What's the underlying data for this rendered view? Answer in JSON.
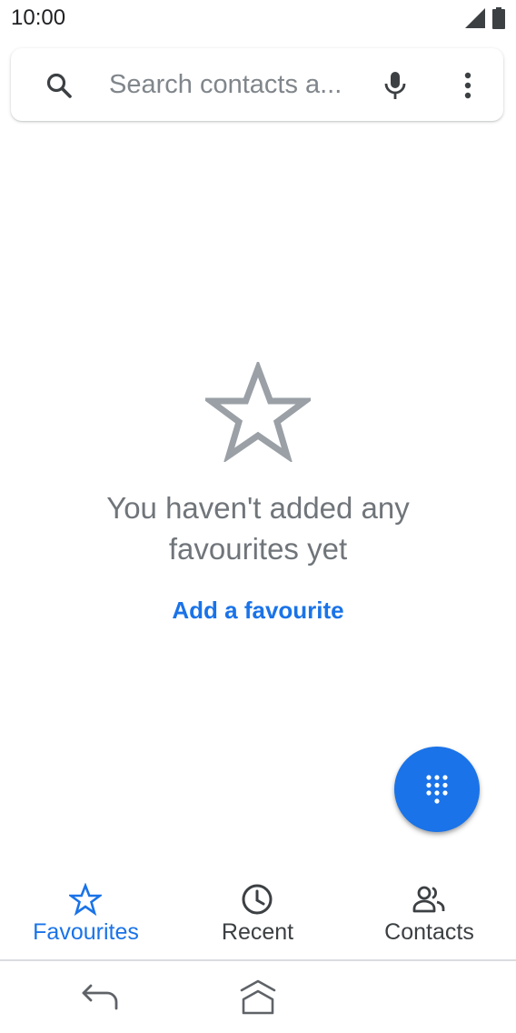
{
  "status_bar": {
    "time": "10:00",
    "icons": [
      "signal-icon",
      "battery-icon"
    ]
  },
  "search": {
    "placeholder": "Search contacts a...",
    "icons": [
      "search-icon",
      "mic-icon",
      "more-vert-icon"
    ]
  },
  "empty_state": {
    "icon": "star-outline-icon",
    "message": "You haven't added any favourites yet",
    "action_label": "Add a favourite"
  },
  "fab": {
    "icon": "dialpad-icon"
  },
  "tabs": [
    {
      "label": "Favourites",
      "icon": "star-outline-icon",
      "active": true
    },
    {
      "label": "Recent",
      "icon": "clock-icon",
      "active": false
    },
    {
      "label": "Contacts",
      "icon": "people-icon",
      "active": false
    }
  ],
  "system_nav": {
    "icons": [
      "back-icon",
      "home-icon"
    ]
  },
  "colors": {
    "accent": "#1a73e8",
    "text_primary": "#202124",
    "text_secondary": "#70757a",
    "icon_gray": "#9aa0a6",
    "divider": "#dadce0"
  }
}
